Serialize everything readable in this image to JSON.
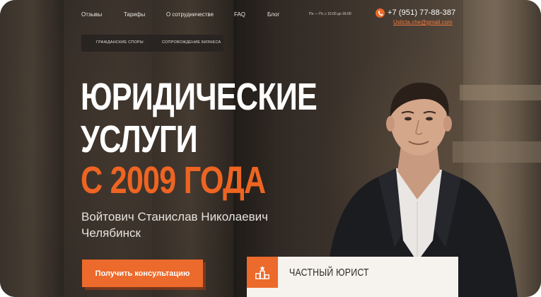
{
  "nav": {
    "items": [
      "Отзывы",
      "Тарифы",
      "О сотрудничестве",
      "FAQ",
      "Блог"
    ],
    "hours": "Пн — Пт, с 10.00 до 18.00",
    "phone": "+7 (951) 77-88-387",
    "email": "Usticla.che@gmail.com"
  },
  "subtabs": [
    "ГРАЖДАНСКИЕ СПОРЫ",
    "СОПРОВОЖДЕНИЕ БИЗНЕСА"
  ],
  "hero": {
    "line1": "ЮРИДИЧЕСКИЕ",
    "line2": "УСЛУГИ",
    "line3": "С 2009 ГОДА",
    "name": "Войтович Станислав Николаевич",
    "city": "Челябинск",
    "cta": "Получить консультацию"
  },
  "badge": {
    "text": "ЧАСТНЫЙ ЮРИСТ",
    "icon": "podium-icon"
  },
  "colors": {
    "accent": "#ec6a2b",
    "text": "#ffffff"
  }
}
